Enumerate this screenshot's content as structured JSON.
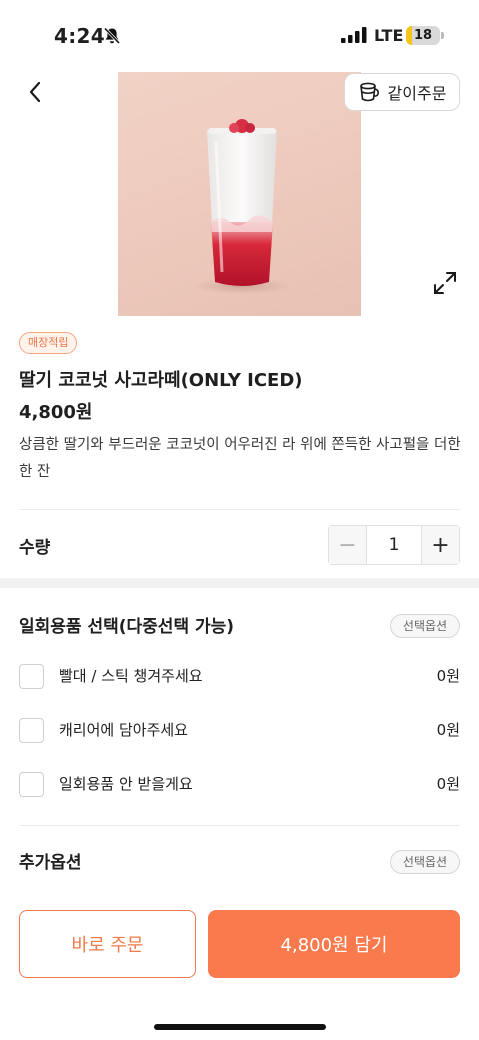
{
  "status_bar": {
    "time": "4:24",
    "network": "LTE",
    "battery_level": "18",
    "battery_fraction": 0.18
  },
  "header": {
    "together_order_label": "같이주문"
  },
  "product": {
    "badge": "매장적립",
    "name": "딸기 코코넛 사고라떼(ONLY ICED)",
    "price": "4,800원",
    "description": "상큼한 딸기와 부드러운 코코넛이 어우러진 라     위에 쫀득한 사고펄을 더한 한 잔"
  },
  "quantity": {
    "label": "수량",
    "value": "1",
    "minus": "−",
    "plus": "+"
  },
  "options": {
    "disposables": {
      "title": "일회용품 선택(다중선택 가능)",
      "badge": "선택옵션",
      "items": [
        {
          "label": "빨대 / 스틱 챙겨주세요",
          "price": "0원"
        },
        {
          "label": "캐리어에 담아주세요",
          "price": "0원"
        },
        {
          "label": "일회용품 안 받을게요",
          "price": "0원"
        }
      ]
    },
    "extra": {
      "title": "추가옵션",
      "badge": "선택옵션"
    }
  },
  "bottom_bar": {
    "buy_now_label": "바로 주문",
    "add_to_cart_label": "4,800원 담기"
  },
  "colors": {
    "accent": "#f97a4d",
    "accent_border": "#f07a4a",
    "badge_text": "#ef7548"
  }
}
